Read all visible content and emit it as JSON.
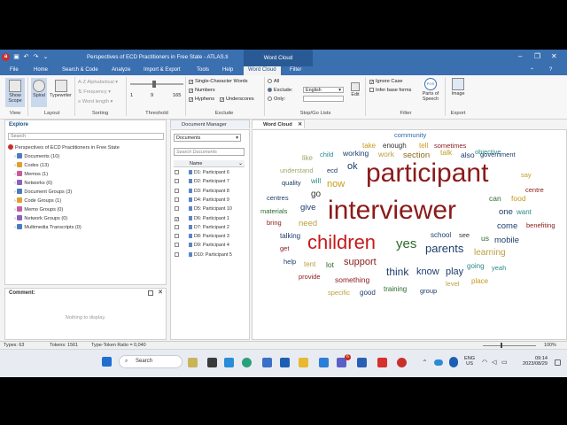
{
  "titlebar": {
    "logo": "a",
    "title": "Perspectives of ECD Practitioners in Free State - ATLAS.ti",
    "context_tab": "Word Cloud"
  },
  "tabs": [
    "File",
    "Home",
    "Search & Code",
    "Analyze",
    "Import & Export",
    "Tools",
    "Help",
    "Word Cloud",
    "Filter"
  ],
  "ribbon": {
    "view": {
      "show_scope": "Show Scope",
      "label": "View"
    },
    "layout": {
      "spiral": "Spiral",
      "typewriter": "Typewriter",
      "label": "Layout"
    },
    "sorting": {
      "alphabetical": "Alphabetical",
      "frequency": "Frequency",
      "word_length": "Word length",
      "label": "Sorting"
    },
    "threshold": {
      "min": "1",
      "mid": "9",
      "max": "165",
      "label": "Threshold"
    },
    "exclude": {
      "single_character": "Single-Character Words",
      "numbers": "Numbers",
      "hyphens": "Hyphens",
      "underscores": "Underscores",
      "label": "Exclude"
    },
    "stopgo": {
      "all": "All",
      "exclude": "Exclude:",
      "only": "Only:",
      "language": "English",
      "edit": "Edit",
      "label": "Stop/Go Lists"
    },
    "filter": {
      "ignore_case": "Ignore Case",
      "infer_base_forms": "Infer base forms",
      "parts_of_speech": "Parts of Speech",
      "pos_badge": "POS",
      "label": "Filter"
    },
    "export": {
      "image": "Image",
      "label": "Export"
    }
  },
  "explore": {
    "title": "Explore",
    "search_placeholder": "Search",
    "project": "Perspectives of ECD Practitioners in Free State",
    "items": [
      {
        "label": "Documents (10)",
        "color": "#4a7bc0"
      },
      {
        "label": "Codes (13)",
        "color": "#e0a030"
      },
      {
        "label": "Memos (1)",
        "color": "#c85aa0"
      },
      {
        "label": "Networks (0)",
        "color": "#8a60c0"
      },
      {
        "label": "Document Groups (3)",
        "color": "#4a7bc0"
      },
      {
        "label": "Code Groups (1)",
        "color": "#e0a030"
      },
      {
        "label": "Memo Groups (0)",
        "color": "#c85aa0"
      },
      {
        "label": "Network Groups (0)",
        "color": "#8a60c0"
      },
      {
        "label": "Multimedia Transcripts (0)",
        "color": "#4a7bc0"
      }
    ]
  },
  "comment": {
    "title": "Comment:",
    "empty": "Nothing to display."
  },
  "doc_tabs": {
    "manager": "Document Manager",
    "cloud": "Word Cloud"
  },
  "docmgr": {
    "dropdown": "Documents",
    "search_placeholder": "Search Documents",
    "col_name": "Name",
    "rows": [
      "D1: Participant 6",
      "D2: Participant 7",
      "D3: Participant 8",
      "D4: Participant 9",
      "D5: Participant 10",
      "D6: Participant 1",
      "D7: Participant 2",
      "D8: Participant 3",
      "D9: Participant 4",
      "D10: Participant 5"
    ],
    "checked_index": 5
  },
  "words": [
    {
      "t": "community",
      "c": "#2b6aa8",
      "s": 7.5
    },
    {
      "t": "take",
      "c": "#c79a1c",
      "s": 8
    },
    {
      "t": "enough",
      "c": "#333333",
      "s": 8
    },
    {
      "t": "tell",
      "c": "#c79a1c",
      "s": 8
    },
    {
      "t": "sometimes",
      "c": "#8b1a1a",
      "s": 7.5
    },
    {
      "t": "objective",
      "c": "#2b8a8a",
      "s": 7.5
    },
    {
      "t": "like",
      "c": "#9aa868",
      "s": 8
    },
    {
      "t": "child",
      "c": "#2b8a8a",
      "s": 7.5
    },
    {
      "t": "working",
      "c": "#1c3d6b",
      "s": 8.5
    },
    {
      "t": "work",
      "c": "#bba040",
      "s": 8.5
    },
    {
      "t": "section",
      "c": "#8a6a18",
      "s": 9.5
    },
    {
      "t": "talk",
      "c": "#c79a1c",
      "s": 8.5
    },
    {
      "t": "also",
      "c": "#1c3d6b",
      "s": 8.5
    },
    {
      "t": "government",
      "c": "#1c3d6b",
      "s": 7.5
    },
    {
      "t": "understand",
      "c": "#9aa868",
      "s": 7.5
    },
    {
      "t": "ecd",
      "c": "#1c3d6b",
      "s": 7.5
    },
    {
      "t": "ok",
      "c": "#1c3d6b",
      "s": 11
    },
    {
      "t": "participant",
      "c": "#8b1a1a",
      "s": 30
    },
    {
      "t": "say",
      "c": "#c79a1c",
      "s": 7.5
    },
    {
      "t": "quality",
      "c": "#1c3d6b",
      "s": 7.5
    },
    {
      "t": "will",
      "c": "#2b8a8a",
      "s": 8
    },
    {
      "t": "now",
      "c": "#c79a1c",
      "s": 11
    },
    {
      "t": "centre",
      "c": "#8b1a1a",
      "s": 7.5
    },
    {
      "t": "go",
      "c": "#333333",
      "s": 10
    },
    {
      "t": "centres",
      "c": "#1c3d6b",
      "s": 7.5
    },
    {
      "t": "can",
      "c": "#2b6a2b",
      "s": 8.5
    },
    {
      "t": "food",
      "c": "#c79a1c",
      "s": 8.5
    },
    {
      "t": "materials",
      "c": "#2b6a2b",
      "s": 7.5
    },
    {
      "t": "give",
      "c": "#1c3d6b",
      "s": 9.5
    },
    {
      "t": "interviewer",
      "c": "#8b1a1a",
      "s": 30
    },
    {
      "t": "one",
      "c": "#1c3d6b",
      "s": 9.5
    },
    {
      "t": "want",
      "c": "#2b8a8a",
      "s": 8
    },
    {
      "t": "bring",
      "c": "#8b1a1a",
      "s": 7.5
    },
    {
      "t": "need",
      "c": "#bba040",
      "s": 9.5
    },
    {
      "t": "come",
      "c": "#1c3d6b",
      "s": 9.5
    },
    {
      "t": "benefiting",
      "c": "#8b1a1a",
      "s": 7.5
    },
    {
      "t": "talking",
      "c": "#1c3d6b",
      "s": 8
    },
    {
      "t": "school",
      "c": "#1c3d6b",
      "s": 8
    },
    {
      "t": "see",
      "c": "#333333",
      "s": 7.5
    },
    {
      "t": "children",
      "c": "#c41a1a",
      "s": 22
    },
    {
      "t": "yes",
      "c": "#2b6a2b",
      "s": 15
    },
    {
      "t": "parents",
      "c": "#1c3d6b",
      "s": 13
    },
    {
      "t": "us",
      "c": "#2b6a2b",
      "s": 8.5
    },
    {
      "t": "mobile",
      "c": "#1c3d6b",
      "s": 9.5
    },
    {
      "t": "get",
      "c": "#8b1a1a",
      "s": 7.5
    },
    {
      "t": "learning",
      "c": "#bba040",
      "s": 10
    },
    {
      "t": "help",
      "c": "#1c3d6b",
      "s": 7.5
    },
    {
      "t": "tent",
      "c": "#bba040",
      "s": 8
    },
    {
      "t": "lot",
      "c": "#2b6a2b",
      "s": 8.5
    },
    {
      "t": "support",
      "c": "#8b1a1a",
      "s": 11
    },
    {
      "t": "going",
      "c": "#2b8a8a",
      "s": 8
    },
    {
      "t": "yeah",
      "c": "#2b8a8a",
      "s": 7.5
    },
    {
      "t": "provide",
      "c": "#8b1a1a",
      "s": 7.5
    },
    {
      "t": "think",
      "c": "#1c3d6b",
      "s": 12
    },
    {
      "t": "know",
      "c": "#1c3d6b",
      "s": 11
    },
    {
      "t": "play",
      "c": "#1c3d6b",
      "s": 11
    },
    {
      "t": "something",
      "c": "#8b1a1a",
      "s": 8.5
    },
    {
      "t": "level",
      "c": "#bba040",
      "s": 7.5
    },
    {
      "t": "place",
      "c": "#c79a1c",
      "s": 8
    },
    {
      "t": "specific",
      "c": "#bba040",
      "s": 7.5
    },
    {
      "t": "good",
      "c": "#1c3d6b",
      "s": 8
    },
    {
      "t": "training",
      "c": "#2b6a2b",
      "s": 8
    },
    {
      "t": "group",
      "c": "#1c3d6b",
      "s": 7.5
    }
  ],
  "status": {
    "types": "Types: 63",
    "tokens": "Tokens: 1561",
    "ratio": "Type-Token Ratio = 0,040",
    "zoom": "100%"
  },
  "taskbar": {
    "search": "Search",
    "lang1": "ENG",
    "lang2": "US",
    "time": "09:14",
    "date": "2023/08/29",
    "badge_teams": "6"
  }
}
